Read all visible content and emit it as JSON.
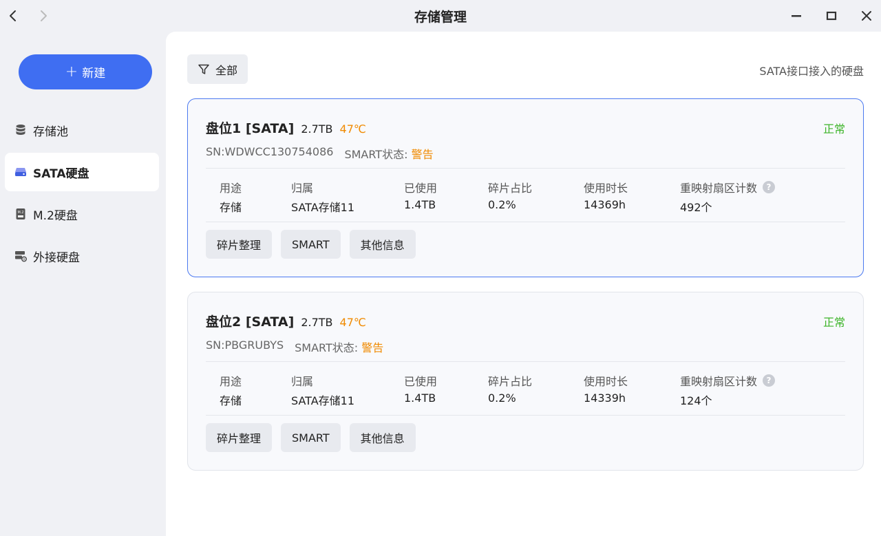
{
  "window": {
    "title": "存储管理"
  },
  "sidebar": {
    "new_label": "新建",
    "items": [
      {
        "label": "存储池",
        "icon": "database-icon"
      },
      {
        "label": "SATA硬盘",
        "icon": "sata-disk-icon",
        "active": true
      },
      {
        "label": "M.2硬盘",
        "icon": "m2-disk-icon"
      },
      {
        "label": "外接硬盘",
        "icon": "external-disk-icon"
      }
    ]
  },
  "main": {
    "filter_label": "全部",
    "hint": "SATA接口接入的硬盘",
    "stat_labels": {
      "usage": "用途",
      "owner": "归属",
      "used": "已使用",
      "fragment": "碎片占比",
      "hours": "使用时长",
      "remap": "重映射扇区计数"
    },
    "actions": {
      "defrag": "碎片整理",
      "smart": "SMART",
      "info": "其他信息"
    },
    "disks": [
      {
        "name": "盘位1 [SATA]",
        "size": "2.7TB",
        "temp": "47℃",
        "status": "正常",
        "sn": "SN:WDWCC130754086",
        "smart_label": "SMART状态:",
        "smart_value": "警告",
        "usage": "存储",
        "owner": "SATA存储11",
        "used": "1.4TB",
        "fragment": "0.2%",
        "hours": "14369h",
        "remap": "492个"
      },
      {
        "name": "盘位2 [SATA]",
        "size": "2.7TB",
        "temp": "47℃",
        "status": "正常",
        "sn": "SN:PBGRUBYS",
        "smart_label": "SMART状态:",
        "smart_value": "警告",
        "usage": "存储",
        "owner": "SATA存储11",
        "used": "1.4TB",
        "fragment": "0.2%",
        "hours": "14339h",
        "remap": "124个"
      }
    ]
  },
  "colors": {
    "accent": "#3f6ef2",
    "ok": "#3cb428",
    "warn": "#f08a00"
  }
}
